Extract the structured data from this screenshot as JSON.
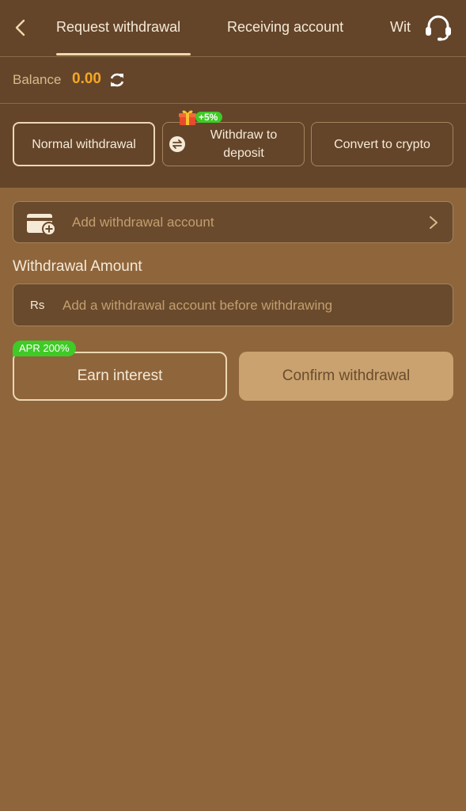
{
  "nav": {
    "tabs": [
      {
        "label": "Request withdrawal",
        "active": true
      },
      {
        "label": "Receiving account",
        "active": false
      },
      {
        "label": "Withdrawal records",
        "active": false
      }
    ],
    "back_icon": "chevron-left-icon",
    "support_icon": "headset-icon"
  },
  "balance": {
    "label": "Balance",
    "value": "0.00",
    "refresh_icon": "refresh-icon"
  },
  "modes": {
    "normal": "Normal withdrawal",
    "deposit_line1": "Withdraw to",
    "deposit_line2": "deposit",
    "deposit_bonus": "+5%",
    "crypto": "Convert to crypto",
    "selected": "Normal withdrawal"
  },
  "account": {
    "label": "Add withdrawal account",
    "icon": "wallet-add-icon"
  },
  "amount": {
    "title": "Withdrawal Amount",
    "currency": "Rs",
    "value": "",
    "placeholder": "Add a withdrawal account before withdrawing"
  },
  "actions": {
    "earn_label": "Earn interest",
    "apr_badge": "APR 200%",
    "confirm_label": "Confirm withdrawal"
  },
  "colors": {
    "background": "#8f653c",
    "header": "#64452a",
    "balance_accent": "#f6a722",
    "badge_green": "#3fca26",
    "confirm_button": "#c9a26f"
  }
}
